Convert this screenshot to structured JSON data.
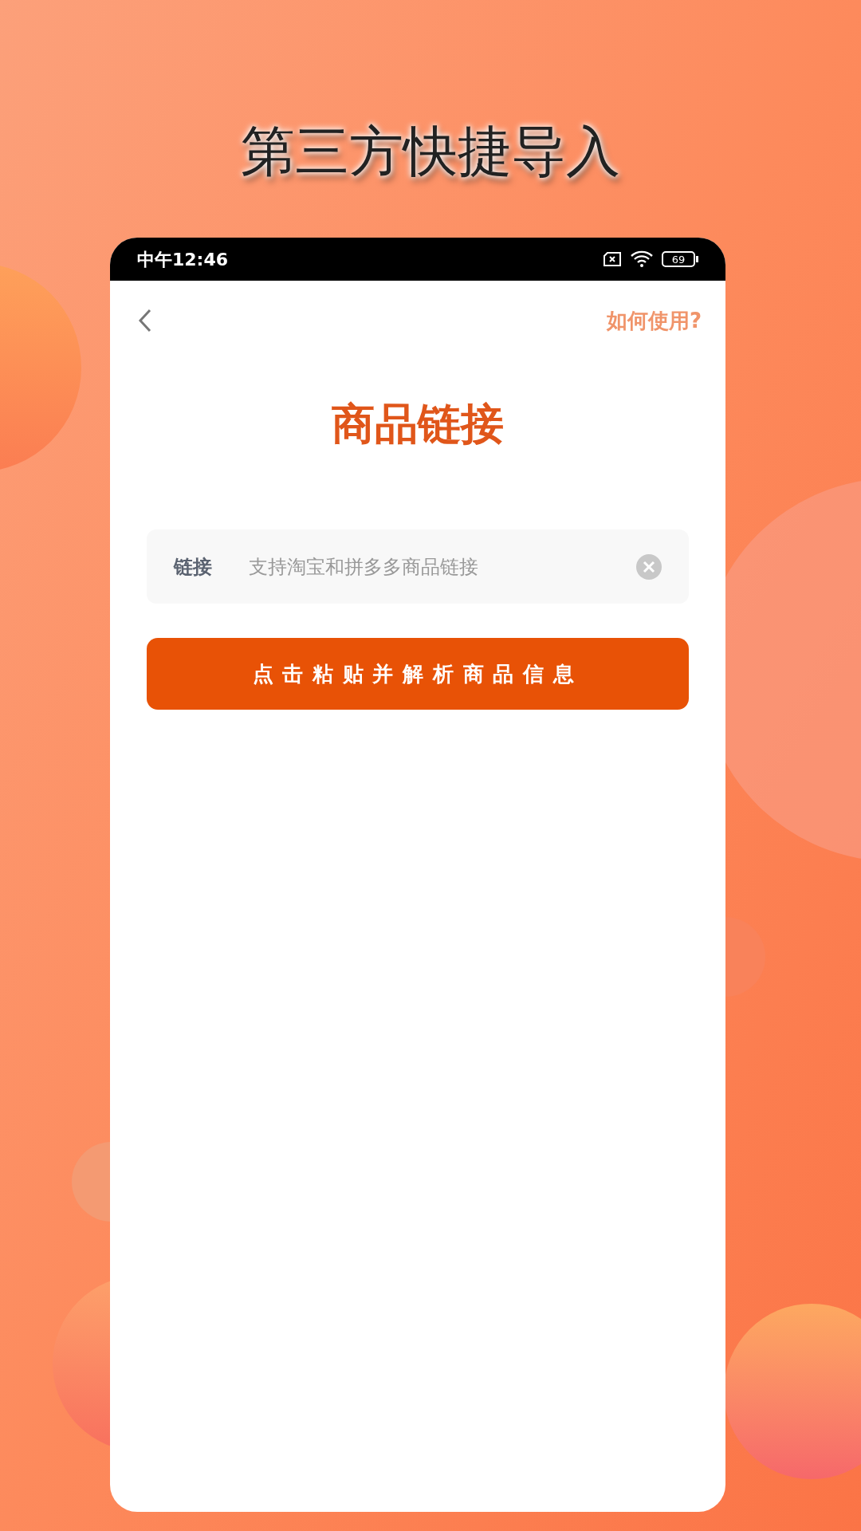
{
  "headline": "第三方快捷导入",
  "status_bar": {
    "time": "中午12:46",
    "battery": "69"
  },
  "nav": {
    "help_link": "如何使用?"
  },
  "page_title": "商品链接",
  "link_field": {
    "label": "链接",
    "placeholder": "支持淘宝和拼多多商品链接"
  },
  "submit_button": "点击粘贴并解析商品信息"
}
